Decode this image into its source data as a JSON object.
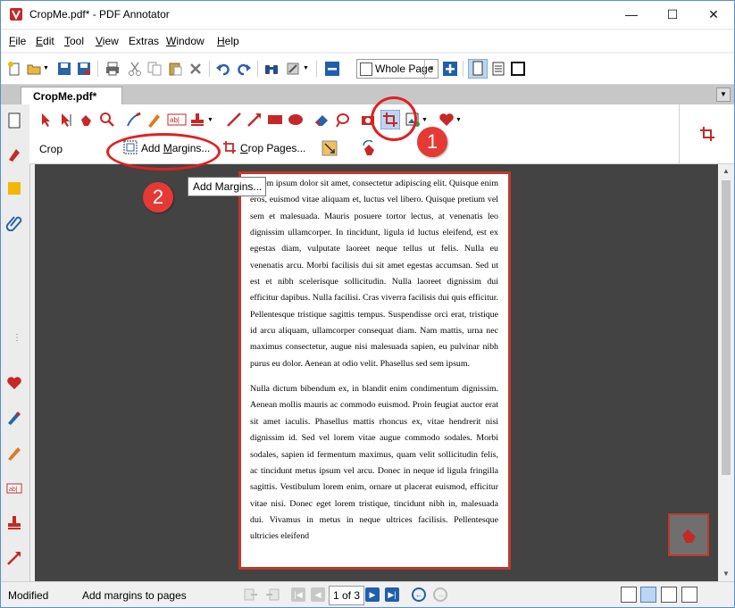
{
  "window": {
    "title": "CropMe.pdf* - PDF Annotator",
    "minimize": "—",
    "maximize": "☐",
    "close": "✕"
  },
  "menu": [
    {
      "u": "F",
      "rest": "ile"
    },
    {
      "u": "E",
      "rest": "dit"
    },
    {
      "u": "T",
      "rest": "ool"
    },
    {
      "u": "V",
      "rest": "iew"
    },
    {
      "u": "",
      "rest": "Extras"
    },
    {
      "u": "W",
      "rest": "indow"
    },
    {
      "u": "H",
      "rest": "elp"
    }
  ],
  "toolbar": {
    "zoom_value": "Whole Page"
  },
  "tab": {
    "label": "CropMe.pdf*"
  },
  "ribbon": {
    "group_label": "Crop",
    "add_margins_label": "Add Margins...",
    "add_margins_accel": "M",
    "crop_pages_label": "Crop Pages...",
    "crop_pages_accel": "C"
  },
  "tooltip": "Add Margins...",
  "callouts": [
    "1",
    "2"
  ],
  "document": {
    "paragraph1": "Lorem ipsum dolor sit amet, consectetur adipiscing elit. Quisque enim eros, euismod vitae aliquam et, luctus vel libero. Quisque pretium vel sem et malesuada. Mauris posuere tortor lectus, at venenatis leo dignissim ullamcorper. In tincidunt, ligula id luctus eleifend, est ex egestas diam, vulputate laoreet neque tellus ut felis. Nulla eu venenatis arcu. Morbi facilisis dui sit amet egestas accumsan. Sed ut est et nibh scelerisque sollicitudin. Nulla laoreet dignissim dui efficitur dapibus. Nulla facilisi. Cras viverra facilisis dui quis efficitur. Pellentesque tristique sagittis tempus. Suspendisse orci erat, tristique id arcu aliquam, ullamcorper consequat diam. Nam mattis, urna nec maximus consectetur, augue nisi malesuada sapien, eu pulvinar nibh purus eu dolor. Aenean at odio velit. Phasellus sed sem ipsum.",
    "paragraph2": "Nulla dictum bibendum ex, in blandit enim condimentum dignissim. Aenean mollis mauris ac commodo euismod. Proin feugiat auctor erat sit amet iaculis. Phasellus mattis rhoncus ex, vitae hendrerit nisi dignissim id. Sed vel lorem vitae augue commodo sodales. Morbi sodales, sapien id fermentum maximus, quam velit sollicitudin felis, ac tincidunt metus ipsum vel arcu. Donec in neque id ligula fringilla sagittis. Vestibulum lorem enim, ornare ut placerat euismod, efficitur vitae nisi. Donec eget lorem tristique, tincidunt nibh in, malesuada dui. Vivamus in metus in neque ultrices facilisis. Pellentesque ultricies eleifend"
  },
  "status": {
    "state": "Modified",
    "hint": "Add margins to pages",
    "page_indicator": "1 of 3"
  },
  "colors": {
    "accent_red": "#e02020",
    "page_border": "#c0392b",
    "nav_blue": "#1f5fad"
  }
}
